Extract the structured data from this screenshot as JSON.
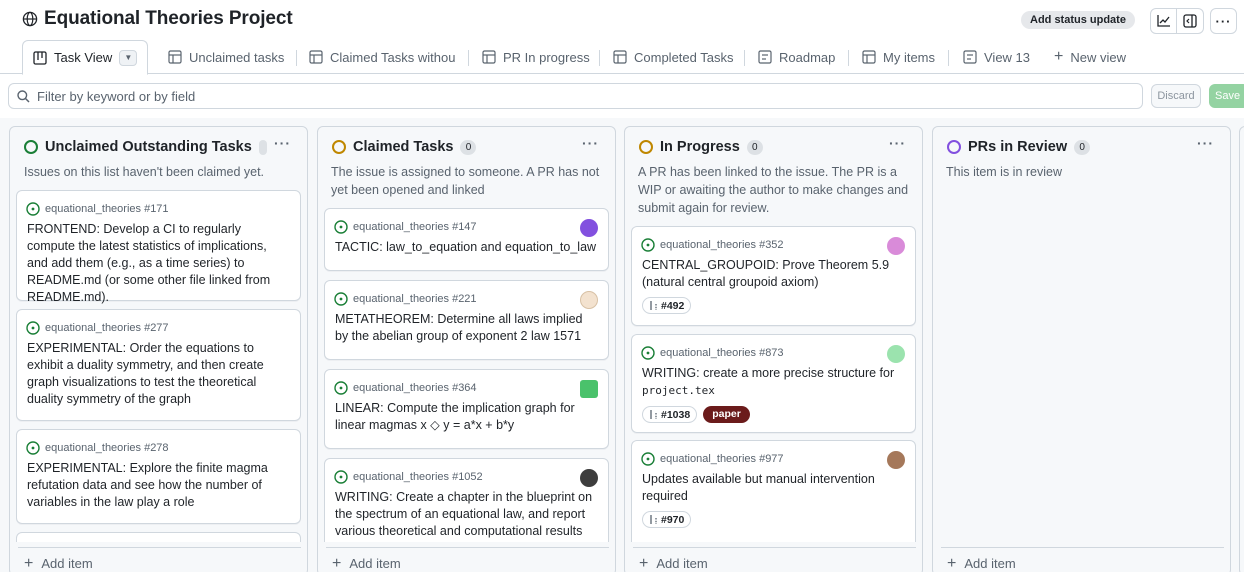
{
  "header": {
    "title": "Equational Theories Project",
    "status_button": "Add status update",
    "icons": [
      "globe-icon",
      "insights-icon",
      "panel-icon",
      "more-icon"
    ]
  },
  "tabs": [
    {
      "label": "Task View",
      "icon": "board-icon",
      "active": true
    },
    {
      "label": "Unclaimed tasks",
      "icon": "table-icon"
    },
    {
      "label": "Claimed Tasks withou",
      "icon": "table-icon"
    },
    {
      "label": "PR In progress",
      "icon": "table-icon"
    },
    {
      "label": "Completed Tasks",
      "icon": "table-icon"
    },
    {
      "label": "Roadmap",
      "icon": "roadmap-icon"
    },
    {
      "label": "My items",
      "icon": "table-icon"
    },
    {
      "label": "View 13",
      "icon": "roadmap-icon"
    },
    {
      "label": "New view",
      "icon": "plus-icon"
    }
  ],
  "filter": {
    "placeholder": "Filter by keyword or by field",
    "discard": "Discard",
    "save": "Save"
  },
  "add_item": "Add item",
  "columns": [
    {
      "title": "Unclaimed Outstanding Tasks",
      "count": "",
      "ring_color": "#1a7f37",
      "description": "Issues on this list haven't been claimed yet.",
      "cards": [
        {
          "meta": "equational_theories #171",
          "title": "FRONTEND: Develop a CI to regularly compute the latest statistics of implications, and add them (e.g., as a time series) to README.md (or some other file linked from README.md)."
        },
        {
          "meta": "equational_theories #277",
          "title": "EXPERIMENTAL: Order the equations to exhibit a duality symmetry, and then create graph visualizations to test the theoretical duality symmetry of the graph"
        },
        {
          "meta": "equational_theories #278",
          "title": "EXPERIMENTAL: Explore the finite magma refutation data and see how the number of variables in the law play a role"
        }
      ]
    },
    {
      "title": "Claimed Tasks",
      "count": "0",
      "ring_color": "#bf8700",
      "description": "The issue is assigned to someone. A PR has not yet been opened and linked",
      "cards": [
        {
          "meta": "equational_theories #147",
          "title": "TACTIC: law_to_equation and equation_to_law",
          "avatar": "#8250df"
        },
        {
          "meta": "equational_theories #221",
          "title": "METATHEOREM: Determine all laws implied by the abelian group of exponent 2 law 1571",
          "avatar": "#e8c9a8"
        },
        {
          "meta": "equational_theories #364",
          "title": "LINEAR: Compute the implication graph for linear magmas x ◇ y = a*x + b*y",
          "avatar": "#4ac26b"
        },
        {
          "meta": "equational_theories #1052",
          "title": "WRITING: Create a chapter in the blueprint on the spectrum of an equational law, and report various theoretical and computational results",
          "avatar": "#3d3d3d"
        }
      ]
    },
    {
      "title": "In Progress",
      "count": "0",
      "ring_color": "#bf8700",
      "description": "A PR has been linked to the issue. The PR is a WIP or awaiting the author to make changes and submit again for review.",
      "cards": [
        {
          "meta": "equational_theories #352",
          "title": "CENTRAL_GROUPOID: Prove Theorem 5.9 (natural central groupoid axiom)",
          "pr": "#492",
          "avatar": "#c24dc2"
        },
        {
          "meta": "equational_theories #873",
          "title": "WRITING: create a more precise structure for",
          "code": "project.tex",
          "pr": "#1038",
          "label": "paper",
          "avatar": "#6fcf86"
        },
        {
          "meta": "equational_theories #977",
          "title": "Updates available but manual intervention required",
          "pr": "#970",
          "avatar": "#a5785a"
        }
      ]
    },
    {
      "title": "PRs in Review",
      "count": "0",
      "ring_color": "#8250df",
      "description": "This item is in review",
      "cards": []
    }
  ]
}
